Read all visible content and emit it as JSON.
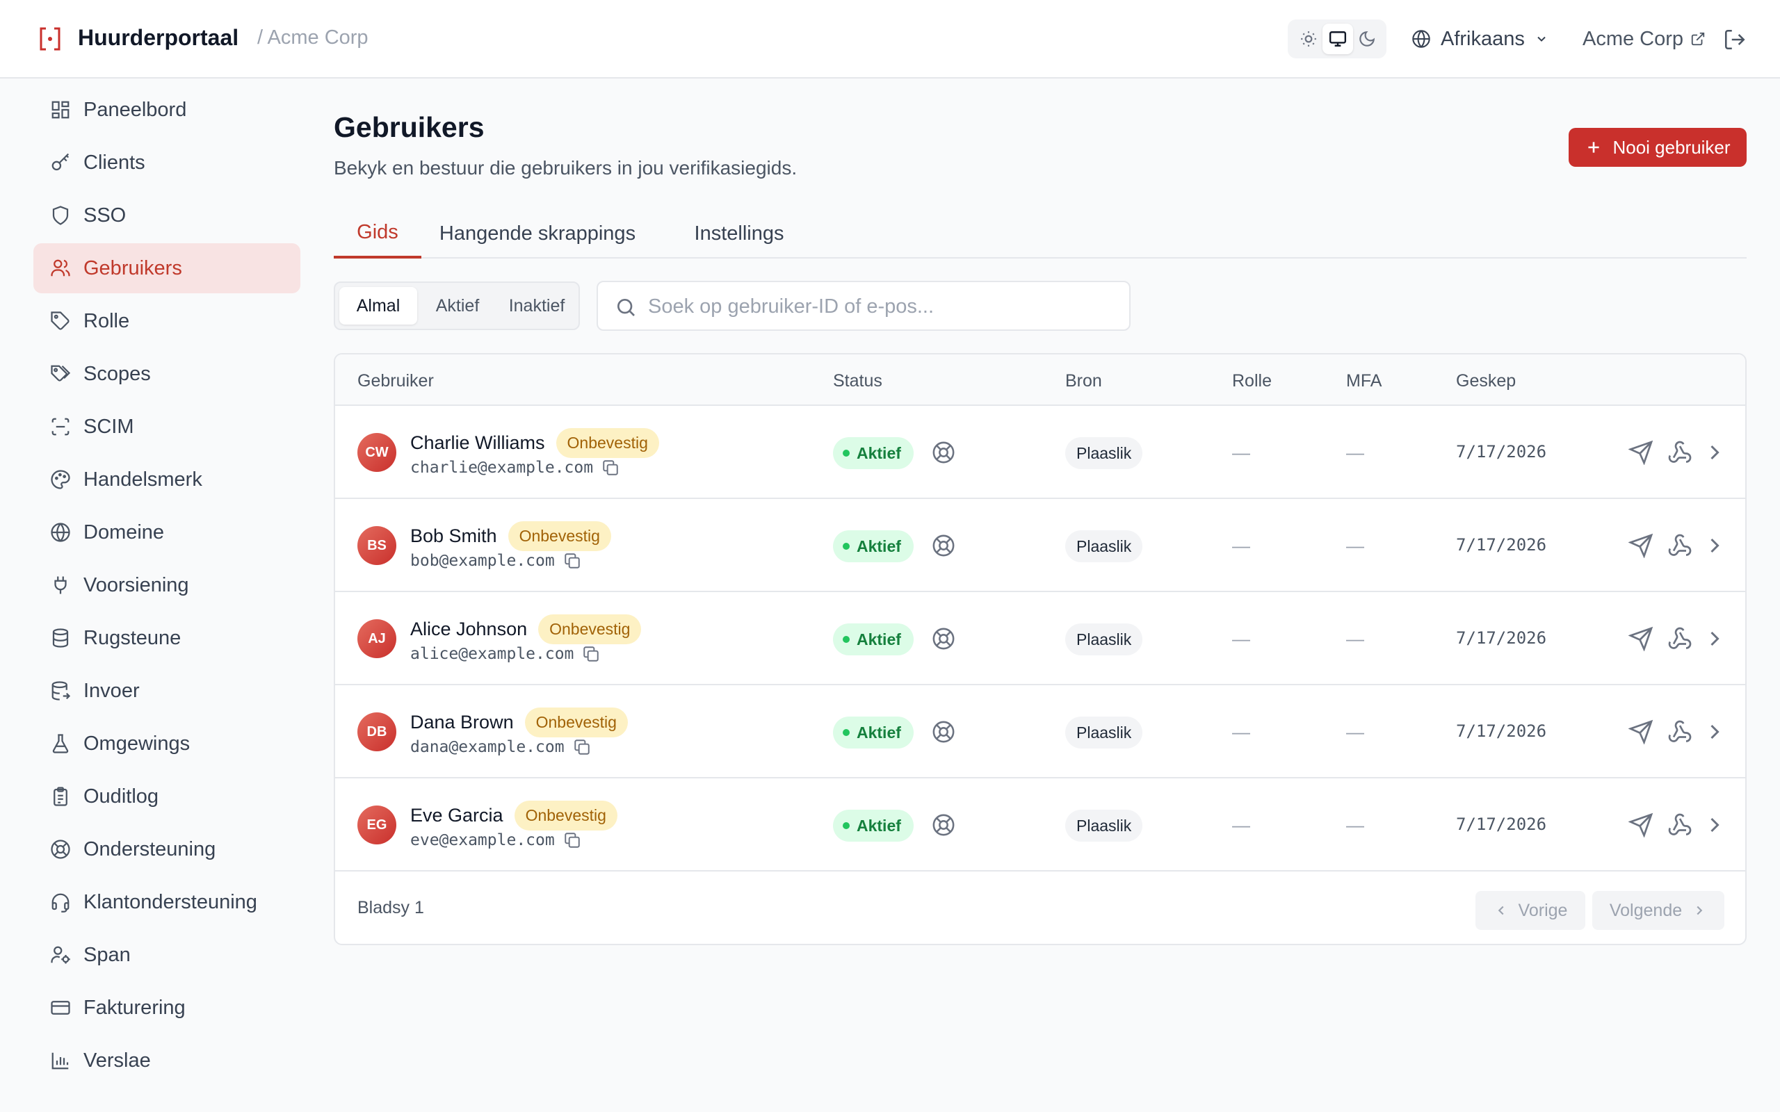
{
  "header": {
    "brand": "Huurderportaal",
    "breadcrumb": "/ Acme Corp",
    "theme_options": [
      "sun-icon",
      "monitor-icon",
      "moon-icon"
    ],
    "theme_selected": "monitor-icon",
    "language": "Afrikaans",
    "org_link": "Acme Corp"
  },
  "sidebar": {
    "items": [
      {
        "label": "Paneelbord",
        "icon": "dashboard-icon"
      },
      {
        "label": "Clients",
        "icon": "key-icon"
      },
      {
        "label": "SSO",
        "icon": "shield-icon"
      },
      {
        "label": "Gebruikers",
        "icon": "users-icon",
        "active": true
      },
      {
        "label": "Rolle",
        "icon": "tag-icon"
      },
      {
        "label": "Scopes",
        "icon": "tags-icon"
      },
      {
        "label": "SCIM",
        "icon": "scan-icon"
      },
      {
        "label": "Handelsmerk",
        "icon": "palette-icon"
      },
      {
        "label": "Domeine",
        "icon": "globe-icon"
      },
      {
        "label": "Voorsiening",
        "icon": "plug-icon"
      },
      {
        "label": "Rugsteune",
        "icon": "database-icon"
      },
      {
        "label": "Invoer",
        "icon": "database-import-icon"
      },
      {
        "label": "Omgewings",
        "icon": "flask-icon"
      },
      {
        "label": "Ouditlog",
        "icon": "clipboard-icon"
      },
      {
        "label": "Ondersteuning",
        "icon": "lifebuoy-icon"
      },
      {
        "label": "Klantondersteuning",
        "icon": "headset-icon"
      },
      {
        "label": "Span",
        "icon": "user-cog-icon"
      },
      {
        "label": "Fakturering",
        "icon": "credit-card-icon"
      },
      {
        "label": "Verslae",
        "icon": "bar-chart-icon"
      }
    ]
  },
  "main": {
    "title": "Gebruikers",
    "subtitle": "Bekyk en bestuur die gebruikers in jou verifikasiegids.",
    "primary_button": "Nooi gebruiker",
    "tabs": [
      {
        "label": "Gids",
        "active": true
      },
      {
        "label": "Hangende skrappings"
      },
      {
        "label": "Instellings"
      }
    ],
    "filters": [
      {
        "label": "Almal",
        "active": true
      },
      {
        "label": "Aktief"
      },
      {
        "label": "Inaktief"
      }
    ],
    "search_placeholder": "Soek op gebruiker-ID of e-pos..."
  },
  "table": {
    "columns": [
      "Gebruiker",
      "Status",
      "Bron",
      "Rolle",
      "MFA",
      "Geskep"
    ],
    "rows": [
      {
        "initials": "CW",
        "name": "Charlie Williams",
        "badge": "Onbevestig",
        "email": "charlie@example.com",
        "status": "Aktief",
        "source": "Plaaslik",
        "roles": "—",
        "mfa": "—",
        "created": "7/17/2026"
      },
      {
        "initials": "BS",
        "name": "Bob Smith",
        "badge": "Onbevestig",
        "email": "bob@example.com",
        "status": "Aktief",
        "source": "Plaaslik",
        "roles": "—",
        "mfa": "—",
        "created": "7/17/2026"
      },
      {
        "initials": "AJ",
        "name": "Alice Johnson",
        "badge": "Onbevestig",
        "email": "alice@example.com",
        "status": "Aktief",
        "source": "Plaaslik",
        "roles": "—",
        "mfa": "—",
        "created": "7/17/2026"
      },
      {
        "initials": "DB",
        "name": "Dana Brown",
        "badge": "Onbevestig",
        "email": "dana@example.com",
        "status": "Aktief",
        "source": "Plaaslik",
        "roles": "—",
        "mfa": "—",
        "created": "7/17/2026"
      },
      {
        "initials": "EG",
        "name": "Eve Garcia",
        "badge": "Onbevestig",
        "email": "eve@example.com",
        "status": "Aktief",
        "source": "Plaaslik",
        "roles": "—",
        "mfa": "—",
        "created": "7/17/2026"
      }
    ],
    "footer": {
      "page_label": "Bladsy 1",
      "prev_label": "Vorige",
      "next_label": "Volgende"
    }
  },
  "colors": {
    "accent": "#c9302c",
    "active_nav_bg": "#f8e3e3",
    "success": "#15803d",
    "warning_badge_bg": "#fdf1c4"
  }
}
